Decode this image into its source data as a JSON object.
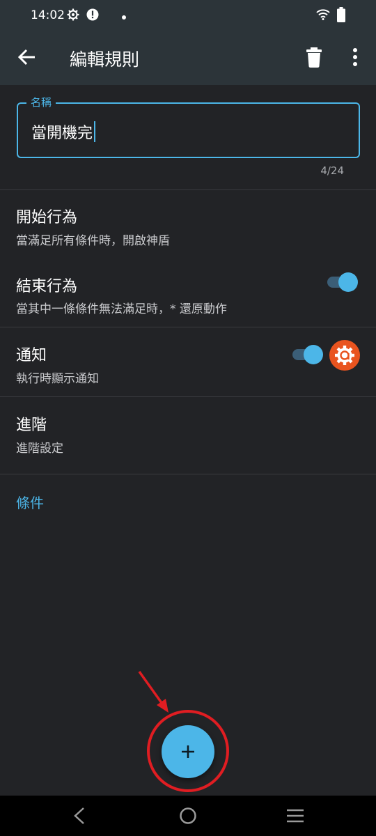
{
  "status_bar": {
    "time": "14:02",
    "icons": [
      "settings-gear-icon",
      "alert-icon",
      "dot-icon",
      "wifi-icon",
      "battery-icon"
    ]
  },
  "app_bar": {
    "title": "編輯規則",
    "icons": [
      "back-arrow-icon",
      "trash-icon",
      "more-vert-icon"
    ]
  },
  "name_field": {
    "label": "名稱",
    "value": "當開機完",
    "counter": "4/24"
  },
  "settings": {
    "start_action": {
      "title": "開始行為",
      "subtitle": "當滿足所有條件時，開啟神盾"
    },
    "end_action": {
      "title": "結束行為",
      "subtitle": "當其中一條條件無法滿足時，* 還原動作",
      "enabled": true
    },
    "notification": {
      "title": "通知",
      "subtitle": "執行時顯示通知",
      "enabled": true,
      "badge_icon": "app-settings-icon"
    },
    "advanced": {
      "title": "進階",
      "subtitle": "進階設定"
    }
  },
  "conditions_header": "條件",
  "fab": {
    "icon": "plus-icon"
  },
  "colors": {
    "accent": "#4cb6e8",
    "appbar": "#2c3439",
    "background": "#222326",
    "badge": "#e9541f",
    "annotation": "#e01d22"
  },
  "nav_bar": {
    "icons": [
      "nav-back-icon",
      "nav-home-icon",
      "nav-recents-icon"
    ]
  }
}
